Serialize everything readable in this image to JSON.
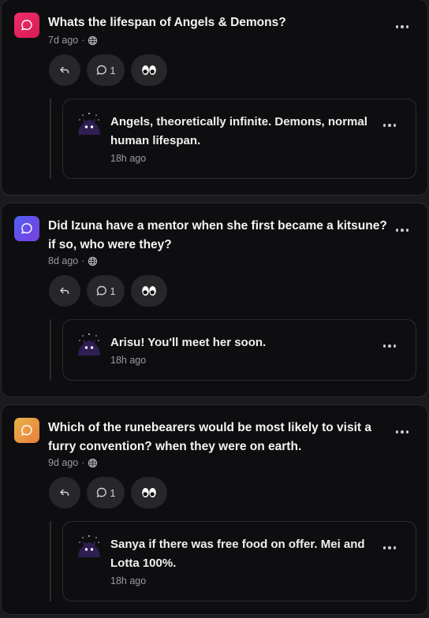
{
  "posts": [
    {
      "question": "Whats the lifespan of Angels & Demons?",
      "time": "7d ago",
      "visibility_icon": "globe-icon",
      "avatar_color": "#e0245e",
      "comment_count": "1",
      "reaction": "👀",
      "answer": {
        "text": "Angels, theoretically infinite. Demons, normal human lifespan.",
        "time": "18h ago"
      }
    },
    {
      "question": "Did Izuna have a mentor when she first became a kitsune? if so, who were they?",
      "time": "8d ago",
      "visibility_icon": "globe-icon",
      "avatar_color": "#5b4de8",
      "comment_count": "1",
      "reaction": "👀",
      "answer": {
        "text": "Arisu! You'll meet her soon.",
        "time": "18h ago"
      }
    },
    {
      "question": "Which of the runebearers would be most likely to visit a furry convention? when they were on earth.",
      "time": "9d ago",
      "visibility_icon": "globe-icon",
      "avatar_color": "#f0a63a",
      "comment_count": "1",
      "reaction": "👀",
      "answer": {
        "text": "Sanya if there was free food on offer. Mei and Lotta 100%.",
        "time": "18h ago"
      }
    }
  ],
  "meta_separator": "·"
}
